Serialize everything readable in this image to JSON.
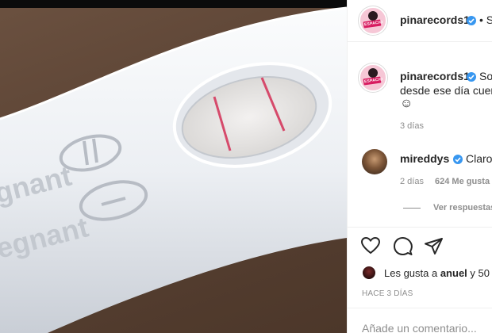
{
  "header": {
    "username": "pinarecords1",
    "follow_fragment": "• S",
    "avatar_logo_text": "ESPACIO"
  },
  "caption": {
    "username": "pinarecords1",
    "text_line1": "So",
    "text_line2": "desde ese día cuen",
    "emoji": "☺",
    "time": "3 días"
  },
  "comment": {
    "username": "mireddys",
    "text": "Claro",
    "time": "2 días",
    "likes": "624 Me gusta",
    "view_replies": "Ver respuestas"
  },
  "actions": {
    "like_icon": "heart-icon",
    "comment_icon": "comment-icon",
    "share_icon": "paper-plane-icon"
  },
  "likes": {
    "prefix": "Les gusta a ",
    "user": "anuel",
    "suffix": " y 50"
  },
  "post_time": "HACE 3 DÍAS",
  "add_comment_placeholder": "Añade un comentario...",
  "colors": {
    "verified": "#3897f0",
    "muted": "#8e8e8e",
    "text": "#262626",
    "test_line": "#d64a6b"
  }
}
